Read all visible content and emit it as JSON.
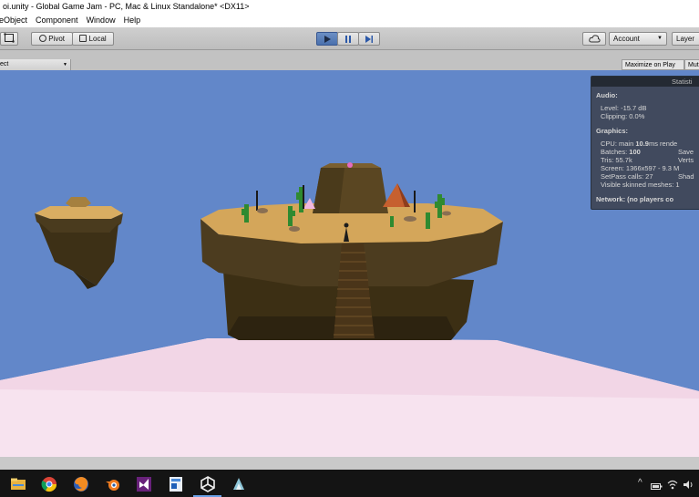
{
  "window": {
    "title": "oi.unity - Global Game Jam - PC, Mac & Linux Standalone* <DX11>"
  },
  "menu": {
    "items": [
      "eObject",
      "Component",
      "Window",
      "Help"
    ]
  },
  "toolbar": {
    "pivot_label": "Pivot",
    "local_label": "Local",
    "account_label": "Account",
    "layers_label": "Layer"
  },
  "viewbar": {
    "display_dropdown": "ect",
    "maximize_label": "Maximize on Play",
    "mute_label": "Mut"
  },
  "stats": {
    "title": "Statisti",
    "audio_header": "Audio:",
    "audio_level": "Level: -15.7 dB",
    "audio_clipping": "Clipping: 0.0%",
    "graphics_header": "Graphics:",
    "cpu_line": "CPU: main",
    "cpu_value": "10.9",
    "cpu_unit": "ms  rende",
    "batches_label": "Batches:",
    "batches_value": "100",
    "saved_label": "Save",
    "tris": "Tris: 55.7k",
    "verts": "Verts",
    "screen": "Screen: 1366x597 - 9.3 M",
    "setpass": "SetPass calls: 27",
    "shadow": "Shad",
    "skinned": "Visible skinned meshes: 1",
    "network": "Network: (no players co"
  },
  "taskbar": {
    "apps": [
      "file-explorer-icon",
      "chrome-icon",
      "firefox-icon",
      "blender-icon",
      "visual-studio-icon",
      "paint-icon",
      "unity-icon",
      "app-icon"
    ],
    "active_app": "unity-icon"
  },
  "colors": {
    "sky": "#6287c9",
    "ground": "#f7e3ef",
    "island_top": "#d6a85e",
    "island_rock": "#4a3a20"
  }
}
